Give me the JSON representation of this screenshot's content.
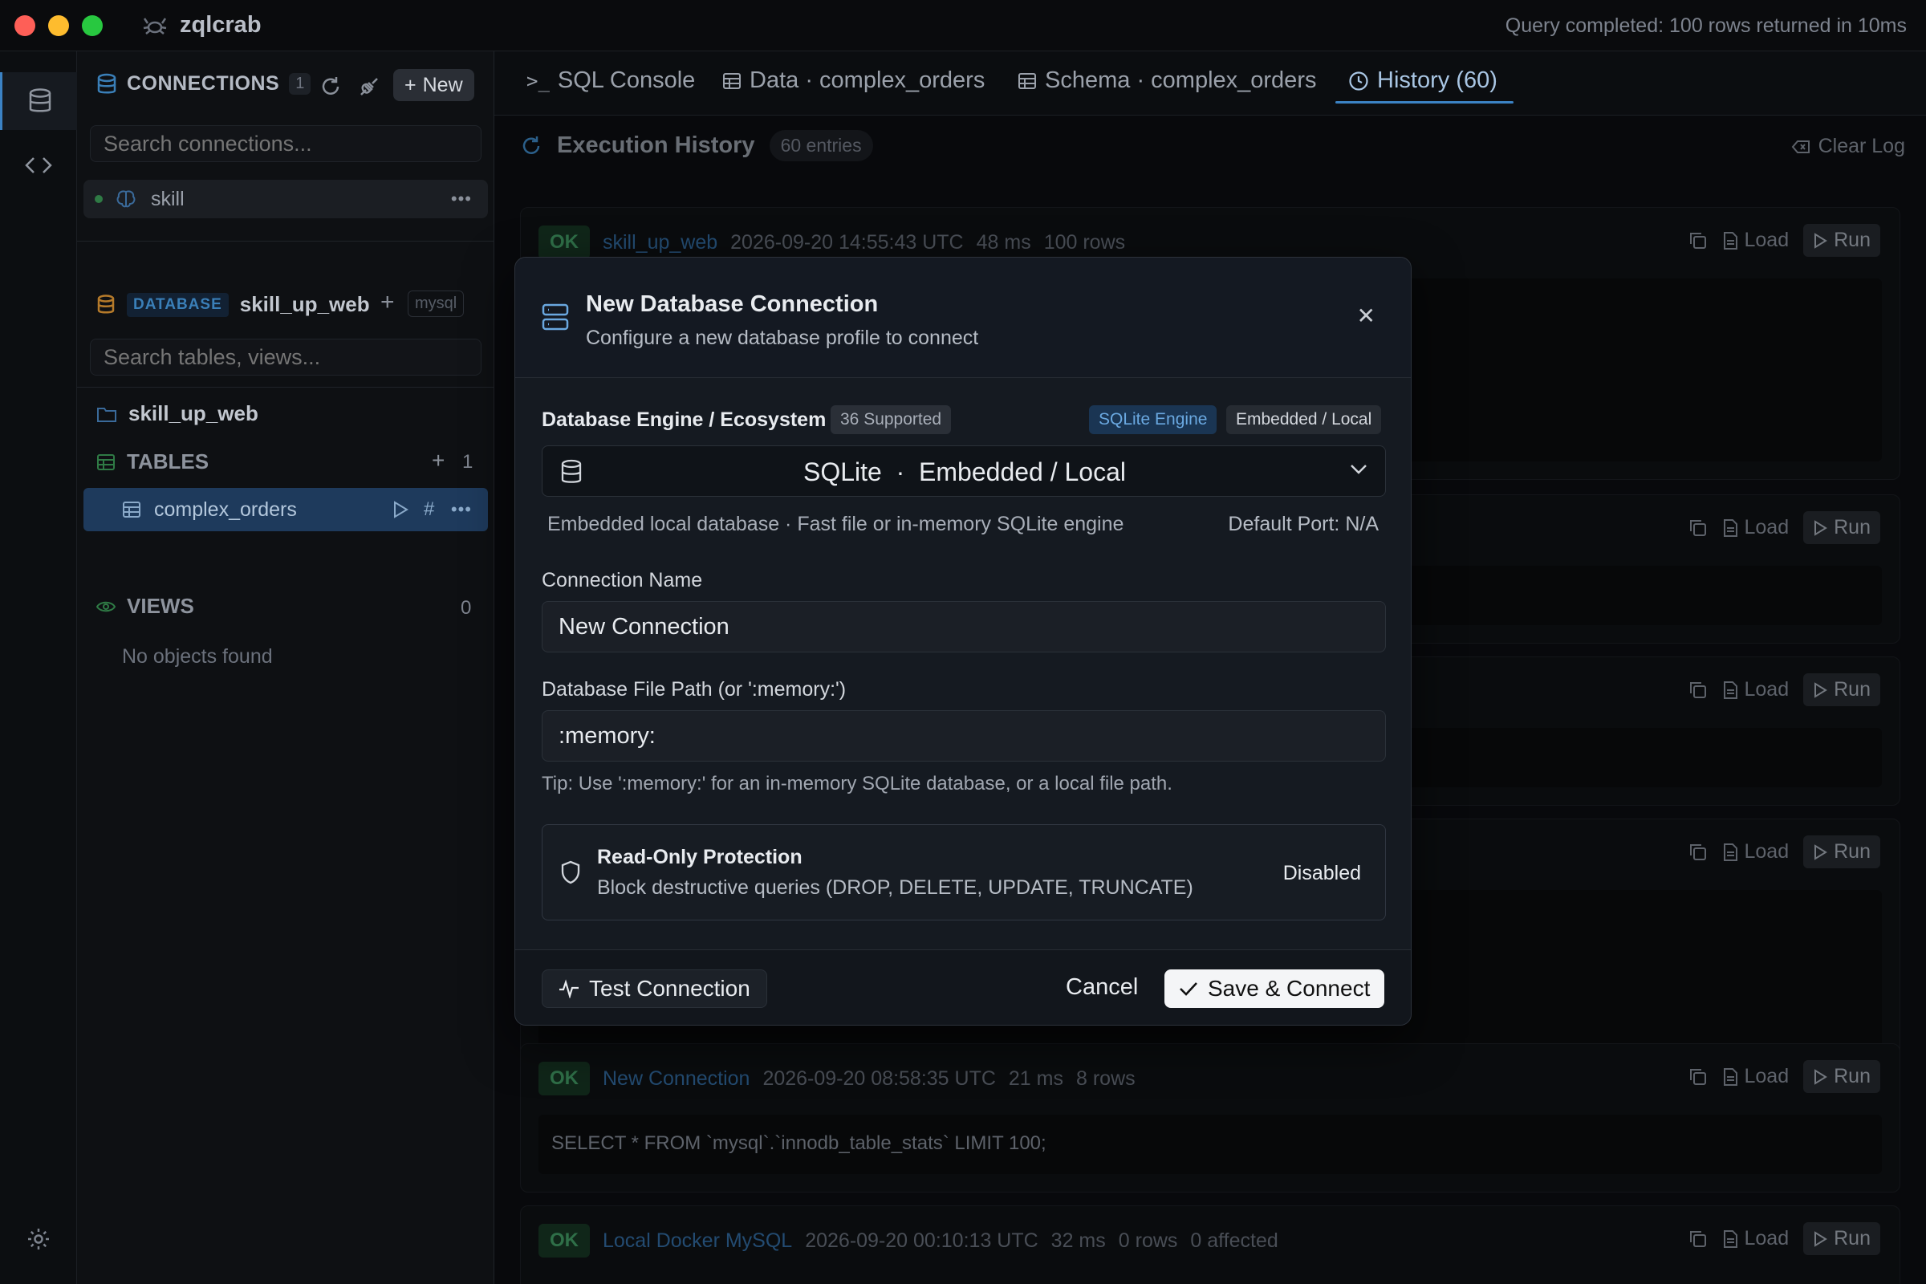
{
  "app": {
    "name": "zqlcrab",
    "status": "Query completed: 100 rows returned in 10ms"
  },
  "sidebar": {
    "connections_title": "CONNECTIONS",
    "connections_count": "1",
    "new_label": "New",
    "search_connections_placeholder": "Search connections...",
    "connection_item": "skill",
    "db_tag": "DATABASE",
    "db_name": "skill_up_web",
    "db_engine": "mysql",
    "search_tables_placeholder": "Search tables, views...",
    "schema_name": "skill_up_web",
    "tables_title": "TABLES",
    "tables_count": "1",
    "table_item": "complex_orders",
    "views_title": "VIEWS",
    "views_count": "0",
    "no_objects": "No objects found"
  },
  "tabs": [
    {
      "label": "SQL Console"
    },
    {
      "label": "Data · complex_orders"
    },
    {
      "label": "Schema · complex_orders"
    },
    {
      "label": "History (60)"
    }
  ],
  "history": {
    "title": "Execution History",
    "entries": "60 entries",
    "clear_label": "Clear Log",
    "load_label": "Load",
    "run_label": "Run",
    "ok_label": "OK",
    "cards": [
      {
        "conn": "skill_up_web",
        "time": "2026-09-20 14:55:43 UTC",
        "duration": "48 ms",
        "rows": "100 rows",
        "extra": "",
        "query": ""
      },
      {
        "conn": "New Connection",
        "time": "2026-09-20 08:58:35 UTC",
        "duration": "21 ms",
        "rows": "8 rows",
        "extra": "",
        "query": "SELECT * FROM `mysql`.`innodb_table_stats` LIMIT 100;"
      },
      {
        "conn": "Local Docker MySQL",
        "time": "2026-09-20 00:10:13 UTC",
        "duration": "32 ms",
        "rows": "0 rows",
        "extra": "0 affected",
        "query": ""
      }
    ]
  },
  "modal": {
    "title": "New Database Connection",
    "subtitle": "Configure a new database profile to connect",
    "engine_label": "Database Engine / Ecosystem",
    "supported": "36 Supported",
    "engine_tag": "SQLite Engine",
    "engine_type_tag": "Embedded / Local",
    "engine_selected": "SQLite  ·  Embedded / Local",
    "engine_desc": "Embedded local database · Fast file or in-memory SQLite engine",
    "default_port": "Default Port: N/A",
    "name_label": "Connection Name",
    "name_value": "New Connection",
    "path_label": "Database File Path (or ':memory:')",
    "path_value": ":memory:",
    "tip": "Tip: Use ':memory:' for an in-memory SQLite database, or a local file path.",
    "ro_title": "Read-Only Protection",
    "ro_sub": "Block destructive queries (DROP, DELETE, UPDATE, TRUNCATE)",
    "ro_state": "Disabled",
    "test_label": "Test Connection",
    "cancel_label": "Cancel",
    "save_label": "Save & Connect"
  }
}
